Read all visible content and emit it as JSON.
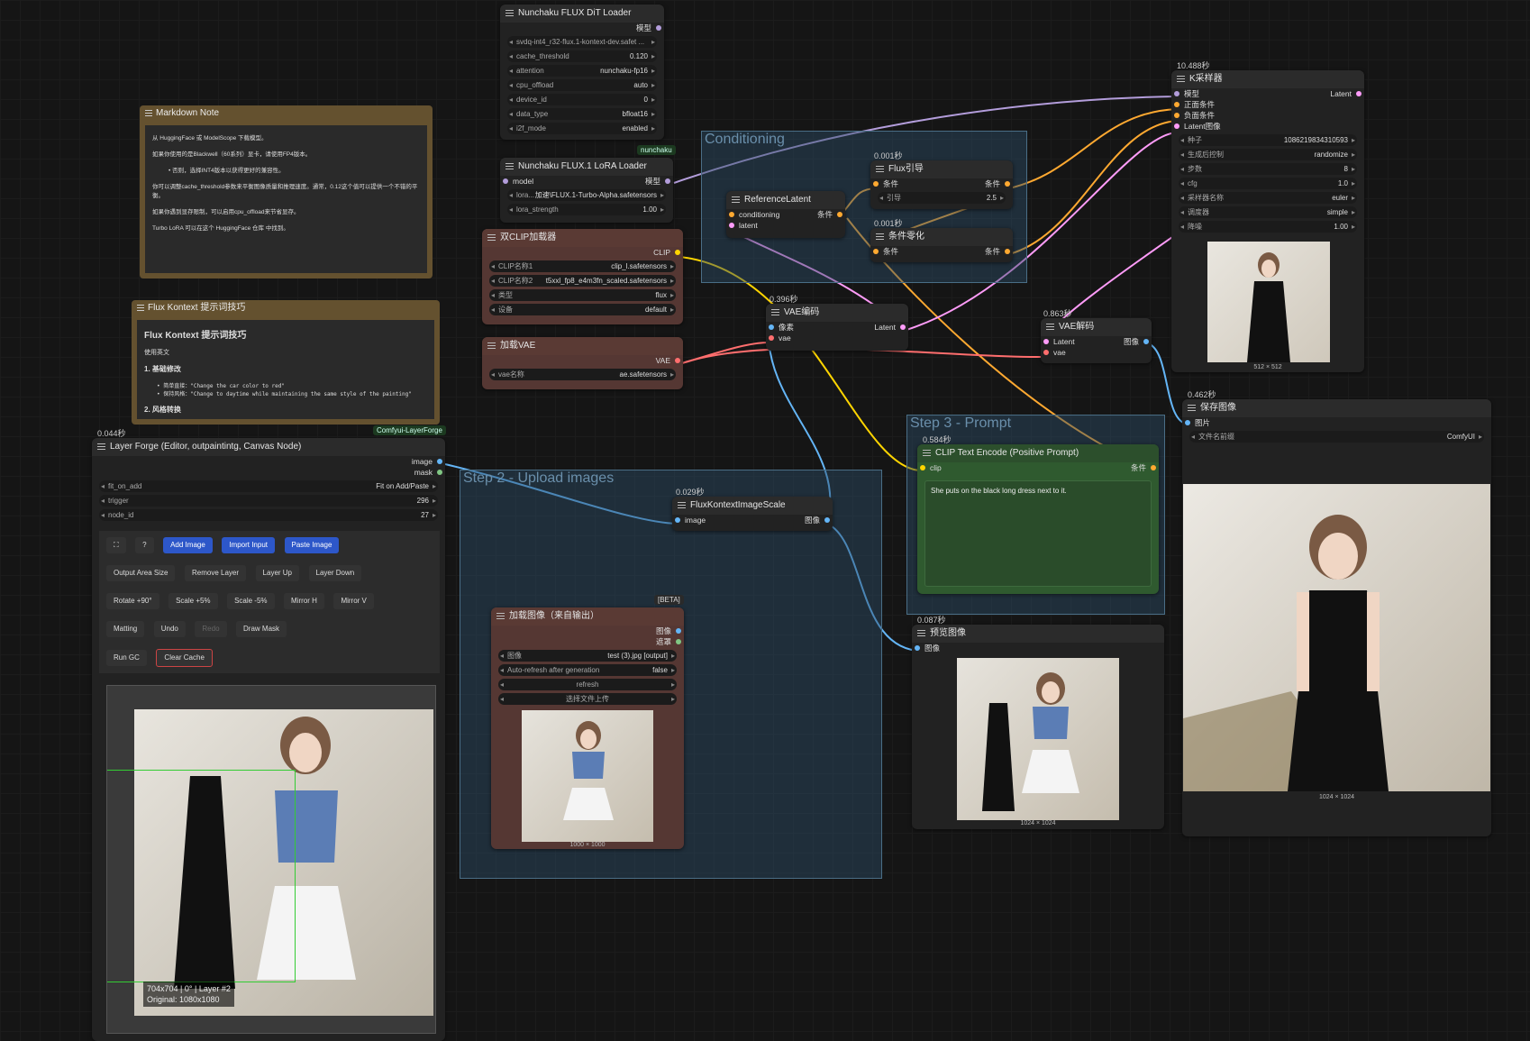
{
  "groups": {
    "conditioning": "Conditioning",
    "step2": "Step 2 - Upload images",
    "step3": "Step 3 - Prompt"
  },
  "dit_loader": {
    "title": "Nunchaku FLUX DiT Loader",
    "out": "模型",
    "widgets": [
      {
        "k": "svdq-int4_r32-flux.1-kontext-dev.safet ...",
        "v": ""
      },
      {
        "k": "cache_threshold",
        "v": "0.120"
      },
      {
        "k": "attention",
        "v": "nunchaku-fp16"
      },
      {
        "k": "cpu_offload",
        "v": "auto"
      },
      {
        "k": "device_id",
        "v": "0"
      },
      {
        "k": "data_type",
        "v": "bfloat16"
      },
      {
        "k": "i2f_mode",
        "v": "enabled"
      }
    ],
    "tag": "nunchaku"
  },
  "lora_loader": {
    "title": "Nunchaku FLUX.1 LoRA Loader",
    "in": "model",
    "out": "模型",
    "widgets": [
      {
        "k": "lora...",
        "v": "加速\\FLUX.1-Turbo-Alpha.safetensors"
      },
      {
        "k": "lora_strength",
        "v": "1.00"
      }
    ]
  },
  "markdown_note": {
    "title": "Markdown Note",
    "lines": [
      "从 HuggingFace 或 ModelScope 下载模型。",
      "如果你使用的是Blackwell（60系列）显卡，请使用FP4版本。",
      "• 否则，选择INT4版本以获得更好的兼容性。",
      "你可以调整cache_threshold参数来平衡图像质量和推理速度。通常，0.12这个值可以提供一个不错的平衡。",
      "如果你遇到显存限制，可以启用cpu_offload来节省显存。",
      "Turbo LoRA 可以在这个 HuggingFace 仓库 中找到。"
    ]
  },
  "flux_tips": {
    "title": "Flux Kontext 提示词技巧",
    "heading": "Flux Kontext 提示词技巧",
    "sub": "使用英文",
    "h1": "1. 基础修改",
    "b1": "• 简单直接：\"Change the car color to red\"",
    "b2": "• 保持风格：\"Change to daytime while maintaining the same style of the painting\"",
    "h2": "2. 风格转换"
  },
  "dual_clip": {
    "title": "双CLIP加载器",
    "out": "CLIP",
    "widgets": [
      {
        "k": "CLIP名称1",
        "v": "clip_l.safetensors"
      },
      {
        "k": "CLIP名称2",
        "v": "t5xxl_fp8_e4m3fn_scaled.safetensors"
      },
      {
        "k": "类型",
        "v": "flux"
      },
      {
        "k": "设备",
        "v": "default"
      }
    ]
  },
  "load_vae": {
    "title": "加载VAE",
    "out": "VAE",
    "widgets": [
      {
        "k": "vae名称",
        "v": "ae.safetensors"
      }
    ]
  },
  "ref_latent": {
    "title": "ReferenceLatent",
    "in1": "conditioning",
    "in2": "latent",
    "out": "条件"
  },
  "flux_guidance": {
    "time": "0.001秒",
    "title": "Flux引导",
    "in": "条件",
    "out": "条件",
    "widgets": [
      {
        "k": "引导",
        "v": "2.5"
      }
    ]
  },
  "cond_zero": {
    "time": "0.001秒",
    "title": "条件零化",
    "in": "条件",
    "out": "条件"
  },
  "vae_encode": {
    "time": "0.396秒",
    "title": "VAE编码",
    "in1": "像素",
    "in2": "vae",
    "out": "Latent"
  },
  "vae_decode": {
    "time": "0.863秒",
    "title": "VAE解码",
    "in1": "Latent",
    "in2": "vae",
    "out": "图像"
  },
  "ksampler": {
    "time": "10.488秒",
    "title": "K采样器",
    "inputs": [
      "模型",
      "正面条件",
      "负面条件",
      "Latent图像"
    ],
    "out": "Latent",
    "widgets": [
      {
        "k": "种子",
        "v": "1086219834310593"
      },
      {
        "k": "生成后控制",
        "v": "randomize"
      },
      {
        "k": "步数",
        "v": "8"
      },
      {
        "k": "cfg",
        "v": "1.0"
      },
      {
        "k": "采样器名称",
        "v": "euler"
      },
      {
        "k": "调度器",
        "v": "simple"
      },
      {
        "k": "降噪",
        "v": "1.00"
      }
    ],
    "caption": "512 × 512"
  },
  "save_image": {
    "time": "0.462秒",
    "title": "保存图像",
    "in": "图片",
    "widgets": [
      {
        "k": "文件名前缀",
        "v": "ComfyUI"
      }
    ],
    "caption": "1024 × 1024"
  },
  "clip_encode": {
    "time": "0.584秒",
    "title": "CLIP Text Encode (Positive Prompt)",
    "in": "clip",
    "out": "条件",
    "prompt": "She puts on the black long dress next to it."
  },
  "image_scale": {
    "time": "0.029秒",
    "title": "FluxKontextImageScale",
    "in": "image",
    "out": "图像"
  },
  "load_image": {
    "badge": "[BETA]",
    "title": "加载图像（来自输出）",
    "out1": "图像",
    "out2": "遮罩",
    "widgets": [
      {
        "k": "图像",
        "v": "test (3).jpg [output]"
      },
      {
        "k": "Auto-refresh after generation",
        "v": "false"
      }
    ],
    "btn_refresh": "refresh",
    "btn_upload": "选择文件上传",
    "caption": "1000 × 1000"
  },
  "preview_image": {
    "time": "0.087秒",
    "title": "预览图像",
    "in": "图像",
    "caption": "1024 × 1024"
  },
  "layer_forge": {
    "time": "0.044秒",
    "tag": "Comfyui-LayerForge",
    "title": "Layer Forge (Editor, outpaintintg, Canvas Node)",
    "out1": "image",
    "out2": "mask",
    "widgets": [
      {
        "k": "fit_on_add",
        "v": "Fit on Add/Paste"
      },
      {
        "k": "trigger",
        "v": "296"
      },
      {
        "k": "node_id",
        "v": "27"
      }
    ],
    "buttons_row1": [
      "⛶",
      "?",
      "Add Image",
      "Import Input",
      "Paste Image"
    ],
    "buttons_row2": [
      "Output Area Size",
      "Remove Layer",
      "Layer Up",
      "Layer Down"
    ],
    "buttons_row3": [
      "Rotate +90°",
      "Scale +5%",
      "Scale -5%",
      "Mirror H",
      "Mirror V"
    ],
    "buttons_row4": [
      "Matting",
      "Undo",
      "Redo",
      "Draw Mask"
    ],
    "buttons_row5": [
      "Run GC",
      "Clear Cache"
    ],
    "canvas_info1": "704x704 | 0° | Layer #2",
    "canvas_info2": "Original: 1080x1080"
  },
  "colors": {
    "model": "#b39ddb",
    "conditioning": "#ffa931",
    "clip": "#ffd500",
    "vae": "#ff6e6e",
    "image": "#64b5f6",
    "latent": "#ff9cf9",
    "mask": "#81c784"
  }
}
